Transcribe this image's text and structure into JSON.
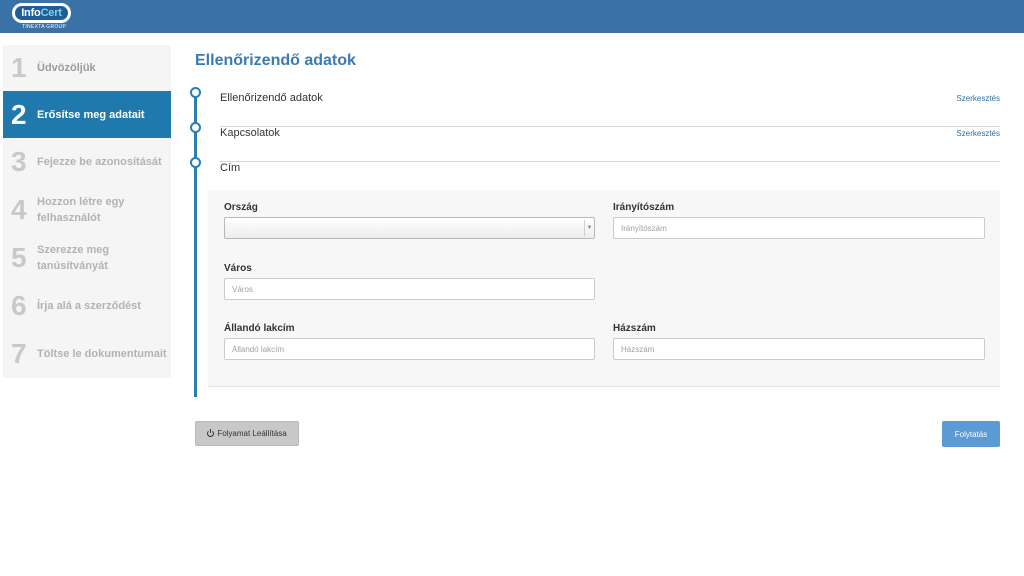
{
  "header": {
    "logo_info": "Info",
    "logo_cert": "Cert",
    "logo_sub": "TINEXTA GROUP"
  },
  "sidebar": {
    "steps": [
      {
        "num": "1",
        "label": "Üdvözöljük"
      },
      {
        "num": "2",
        "label": "Erősítse meg adatait"
      },
      {
        "num": "3",
        "label": "Fejezze be azonosítását"
      },
      {
        "num": "4",
        "label": "Hozzon létre egy felhasználót"
      },
      {
        "num": "5",
        "label": "Szerezze meg tanúsítványát"
      },
      {
        "num": "6",
        "label": "Írja alá a szerződést"
      },
      {
        "num": "7",
        "label": "Töltse le dokumentumait"
      }
    ],
    "active_step": 2
  },
  "main": {
    "title": "Ellenőrizendő adatok",
    "sections": [
      {
        "name": "Ellenőrizendő adatok",
        "edit": "Szerkesztés"
      },
      {
        "name": "Kapcsolatok",
        "edit": "Szerkesztés"
      },
      {
        "name": "Cím"
      }
    ],
    "form": {
      "country": {
        "label": "Ország",
        "value": ""
      },
      "zip": {
        "label": "Irányítószám",
        "placeholder": "Irányítószám"
      },
      "city": {
        "label": "Város",
        "placeholder": "Város"
      },
      "address": {
        "label": "Állandó lakcím",
        "placeholder": "Állandó lakcím"
      },
      "house": {
        "label": "Házszám",
        "placeholder": "Házszám"
      }
    },
    "buttons": {
      "stop": "Folyamat Leállítása",
      "continue": "Folytatás"
    }
  },
  "colors": {
    "header": "#3a72a7",
    "accent": "#1f79ad",
    "primary_button": "#5b9bd5"
  }
}
